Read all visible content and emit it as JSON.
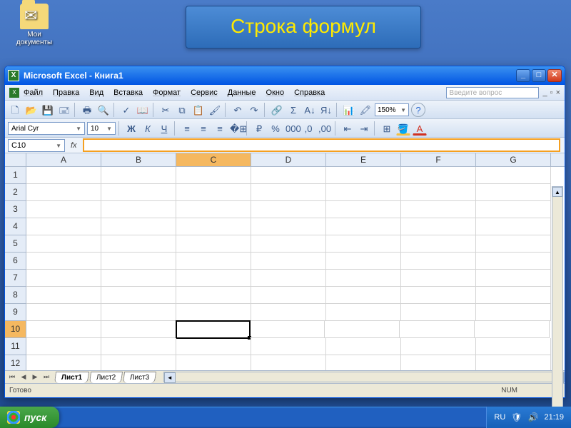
{
  "desktop": {
    "mydocs": "Мои документы"
  },
  "callout": "Строка формул",
  "window": {
    "title": "Microsoft Excel - Книга1",
    "menus": [
      "Файл",
      "Правка",
      "Вид",
      "Вставка",
      "Формат",
      "Сервис",
      "Данные",
      "Окно",
      "Справка"
    ],
    "help_placeholder": "Введите вопрос",
    "zoom": "150%",
    "font_name": "Arial Cyr",
    "font_size": "10",
    "name_box": "C10",
    "formula": "",
    "columns": [
      "A",
      "B",
      "C",
      "D",
      "E",
      "F",
      "G"
    ],
    "rows": [
      "1",
      "2",
      "3",
      "4",
      "5",
      "6",
      "7",
      "8",
      "9",
      "10",
      "11",
      "12"
    ],
    "active_col": "C",
    "active_row": "10",
    "sheets": [
      "Лист1",
      "Лист2",
      "Лист3"
    ],
    "active_sheet": "Лист1",
    "status": "Готово",
    "num_indicator": "NUM"
  },
  "taskbar": {
    "start": "пуск",
    "lang": "RU",
    "time": "21:19"
  },
  "icons": {
    "new": "🗋",
    "open": "📂",
    "save": "💾",
    "perm": "🖃",
    "print": "🖶",
    "preview": "🔍",
    "spell": "✓",
    "research": "📖",
    "cut": "✂",
    "copy": "⧉",
    "paste": "📋",
    "fmtpaint": "🖌",
    "undo": "↶",
    "redo": "↷",
    "link": "🔗",
    "sum": "Σ",
    "sortasc": "A↓",
    "sortdesc": "Я↓",
    "chart": "📊",
    "draw": "🖍",
    "help": "?",
    "bold": "Ж",
    "italic": "К",
    "underline": "Ч",
    "alignl": "≡",
    "alignc": "≡",
    "alignr": "≡",
    "merge": "�⊞",
    "currency": "₽",
    "percent": "%",
    "comma": "000",
    "decinc": ",0",
    "decdec": ",00",
    "outdent": "⇤",
    "indent": "⇥",
    "border": "⊞",
    "fill": "🪣",
    "fontcolor": "A"
  }
}
